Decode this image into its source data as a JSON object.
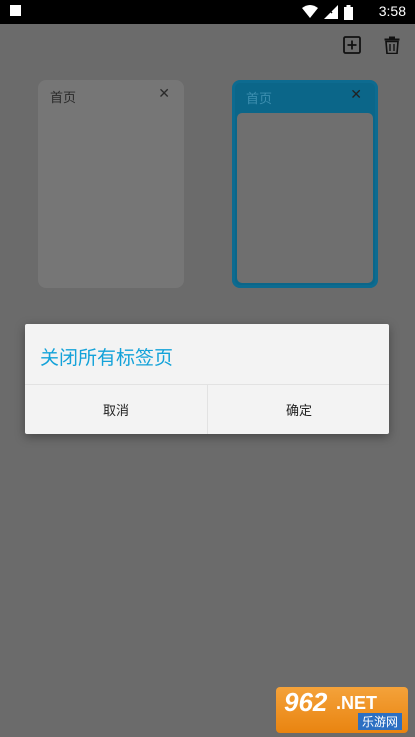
{
  "status_bar": {
    "time": "3:58"
  },
  "toolbar": {
    "add_tab_icon": "add-box-icon",
    "delete_icon": "trash-icon"
  },
  "tabs": [
    {
      "title": "首页",
      "close": "✕",
      "active": false
    },
    {
      "title": "首页",
      "close": "✕",
      "active": true
    }
  ],
  "dialog": {
    "title": "关闭所有标签页",
    "cancel_label": "取消",
    "ok_label": "确定"
  },
  "watermark": {
    "number": "962",
    "suffix": ".NET",
    "site": "乐游网"
  },
  "colors": {
    "accent": "#13a2d9",
    "active_tab": "#0b6689",
    "background": "#6b6b6b",
    "dialog_bg": "#f3f3f3"
  }
}
